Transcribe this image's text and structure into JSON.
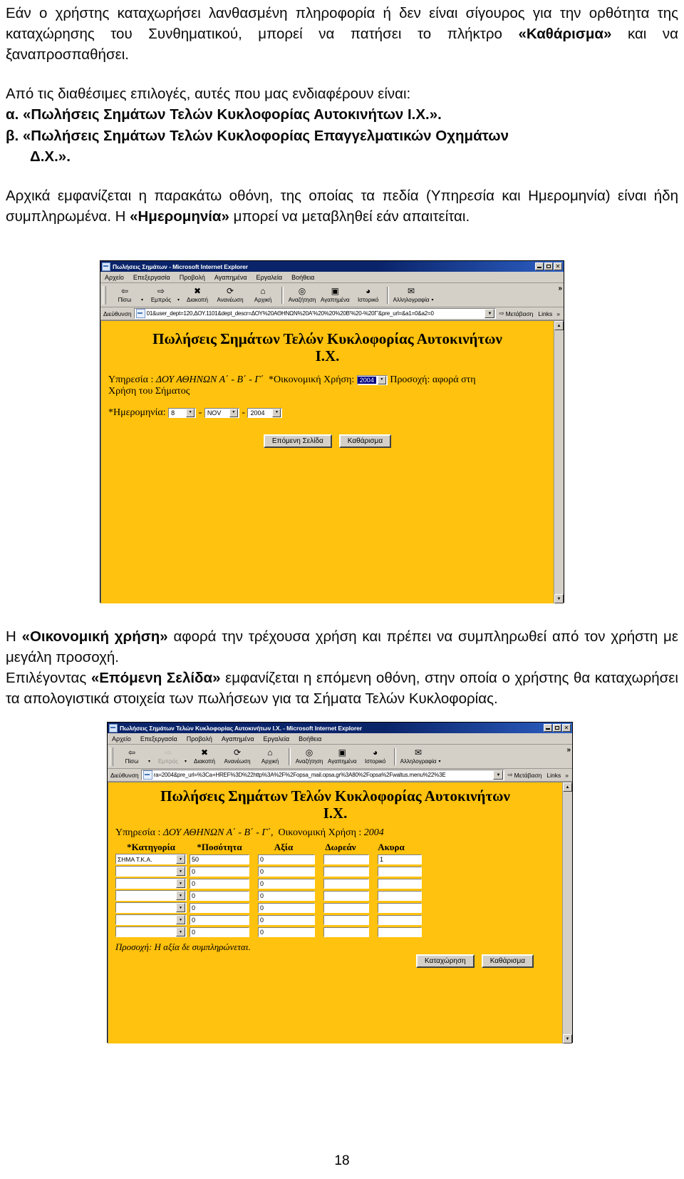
{
  "document": {
    "page_number": "18",
    "paragraphs_top": [
      "Εάν ο χρήστης καταχωρήσει λανθασμένη πληροφορία ή δεν είναι σίγουρος για την ορθότητα της καταχώρησης του Συνθηματικού, μπορεί να πατήσει το πλήκτρο ",
      "Από τις διαθέσιμες επιλογές, αυτές που μας ενδιαφέρουν είναι:"
    ],
    "p1_bold": "«Καθάρισμα»",
    "p1_tail": " και να ξαναπροσπαθήσει.",
    "list_a": "α. «Πωλήσεις Σημάτων Τελών Κυκλοφορίας Αυτοκινήτων Ι.Χ.».",
    "list_b": "β. «Πωλήσεις Σημάτων Τελών Κυκλοφορίας Επαγγελματικών Οχημάτων",
    "list_b2": "Δ.Χ.».",
    "p3_a": "Αρχικά εμφανίζεται η παρακάτω οθόνη, της οποίας τα πεδία (Υπηρεσία και Ημερομηνία) είναι ήδη συμπληρωμένα. Η ",
    "p3_bold": "«Ημερομηνία»",
    "p3_b": " μπορεί να μεταβληθεί εάν απαιτείται.",
    "p4_bold": "«Οικονομική χρήση»",
    "p4_a": "Η ",
    "p4_b": " αφορά την τρέχουσα χρήση και πρέπει να συμπληρωθεί από τον χρήστη με μεγάλη προσοχή.",
    "p5_a": "Επιλέγοντας ",
    "p5_bold": "«Επόμενη Σελίδα»",
    "p5_b": " εμφανίζεται η επόμενη οθόνη, στην οποία ο χρήστης θα καταχωρήσει τα απολογιστικά στοιχεία των πωλήσεων για τα Σήματα Τελών Κυκλοφορίας."
  },
  "browser_chrome": {
    "menu": [
      "Αρχείο",
      "Επεξεργασία",
      "Προβολή",
      "Αγαπημένα",
      "Εργαλεία",
      "Βοήθεια"
    ],
    "toolbar": [
      {
        "label": "Πίσω",
        "icon": "back-arrow-icon",
        "glyph": "⇦"
      },
      {
        "label": "Εμπρός",
        "icon": "forward-arrow-icon",
        "glyph": "⇨"
      },
      {
        "label": "Διακοπή",
        "icon": "stop-icon",
        "glyph": "✖"
      },
      {
        "label": "Ανανέωση",
        "icon": "refresh-icon",
        "glyph": "⟳"
      },
      {
        "label": "Αρχική",
        "icon": "home-icon",
        "glyph": "⌂"
      },
      {
        "label": "Αναζήτηση",
        "icon": "search-icon",
        "glyph": "🔍"
      },
      {
        "label": "Αγαπημένα",
        "icon": "favorites-icon",
        "glyph": "★"
      },
      {
        "label": "Ιστορικό",
        "icon": "history-icon",
        "glyph": "◔"
      },
      {
        "label": "Αλληλογραφία",
        "icon": "mail-icon",
        "glyph": "✉"
      }
    ],
    "address_label": "Διεύθυνση",
    "go_label": "Μετάβαση",
    "links_label": "Links",
    "chevron": "»",
    "min_label": "_",
    "max_label": "□",
    "close_label": "✕"
  },
  "window1": {
    "title": "Πωλήσεις Σημάτων - Microsoft Internet Explorer",
    "url": "01&user_dept=120,ΔΟΥ.1101&dept_descr=ΔΟΥ%20ΑΘΗΝΩΝ%20Α'%20%20%20Β'%20-%20Γ'&pre_url=&a1=0&a2=0",
    "form": {
      "title_line1": "Πωλήσεις Σημάτων Τελών Κυκλοφορίας Αυτοκινήτων",
      "title_line2": "Ι.Χ.",
      "service_label": "Υπηρεσία :",
      "service_value": "ΔΟΥ ΑΘΗΝΩΝ Α΄ - Β΄ - Γ΄",
      "fiscal_label": "*Οικονομική Χρήση:",
      "fiscal_value": "2004",
      "fiscal_note_line1": "Προσοχή: αφορά στη",
      "fiscal_note_line2": "Χρήση του Σήματος",
      "date_label": "*Ημερομηνία:",
      "date_day": "8",
      "date_month": "NOV",
      "date_year": "2004",
      "btn_next": "Επόμενη Σελίδα",
      "btn_clear": "Καθάρισμα"
    }
  },
  "window2": {
    "title": "Πωλήσεις Σημάτων Τελών Κυκλοφορίας Αυτοκινήτων Ι.Χ. - Microsoft Internet Explorer",
    "url": "ra=2004&pre_url=%3Ca+HREF%3D%22http%3A%2F%2Fopsa_mail.opsa.gr%3A80%2Fopsa%2Fwaltus.menu%22%3E",
    "form": {
      "title_line1": "Πωλήσεις Σημάτων Τελών Κυκλοφορίας Αυτοκινήτων",
      "title_line2": "Ι.Χ.",
      "service_label": "Υπηρεσία :",
      "service_value": "ΔΟΥ ΑΘΗΝΩΝ Α΄ - Β΄ - Γ΄",
      "fiscal_sep": ",",
      "fiscal_label": "Οικονομική Χρήση :",
      "fiscal_value": "2004",
      "columns": [
        "*Κατηγορία",
        "*Ποσότητα",
        "Αξία",
        "Δωρεάν",
        "Ακυρα"
      ],
      "rows": [
        {
          "category": "ΣΗΜΑ Τ.Κ.Α.",
          "quantity": "50",
          "value": "0",
          "free": "",
          "cancel": "1"
        },
        {
          "category": "",
          "quantity": "0",
          "value": "0",
          "free": "",
          "cancel": ""
        },
        {
          "category": "",
          "quantity": "0",
          "value": "0",
          "free": "",
          "cancel": ""
        },
        {
          "category": "",
          "quantity": "0",
          "value": "0",
          "free": "",
          "cancel": ""
        },
        {
          "category": "",
          "quantity": "0",
          "value": "0",
          "free": "",
          "cancel": ""
        },
        {
          "category": "",
          "quantity": "0",
          "value": "0",
          "free": "",
          "cancel": ""
        },
        {
          "category": "",
          "quantity": "0",
          "value": "0",
          "free": "",
          "cancel": ""
        }
      ],
      "notice": "Προσοχή: Η αξία δε συμπληρώνεται.",
      "btn_submit": "Καταχώρηση",
      "btn_clear": "Καθάρισμα"
    }
  },
  "colors": {
    "page_bg": "#ffc20e",
    "titlebar": "#0a246a",
    "chrome": "#d4d0c8"
  }
}
